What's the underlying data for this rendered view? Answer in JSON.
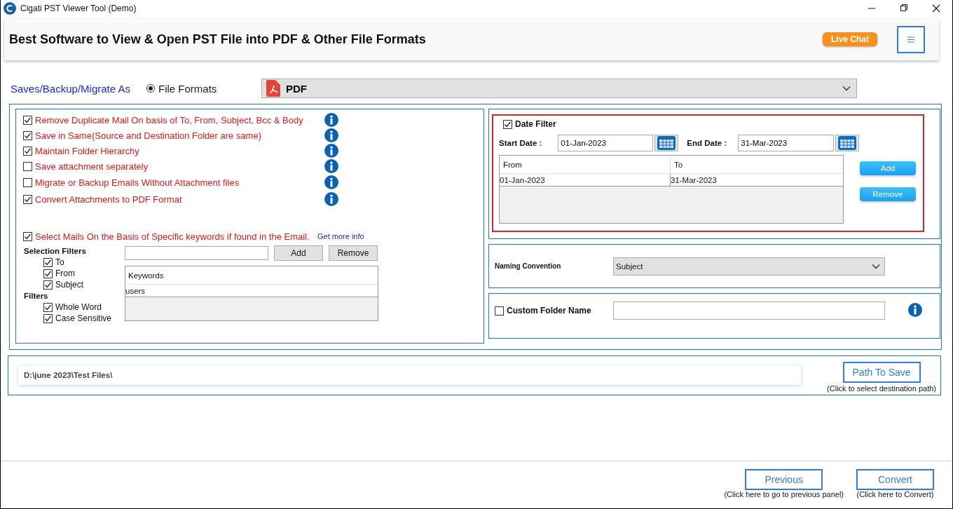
{
  "window": {
    "title": "Cigati PST Viewer Tool (Demo)"
  },
  "header": {
    "headline": "Best Software to View & Open PST File into PDF & Other File Formats",
    "live_chat": "Live Chat"
  },
  "save_as": {
    "label": "Saves/Backup/Migrate As",
    "option": {
      "label": "File Formats",
      "selected": true
    },
    "format": "PDF"
  },
  "options": [
    {
      "label": "Remove Duplicate Mail On basis of To, From, Subject, Bcc & Body",
      "checked": true
    },
    {
      "label": "Save in Same(Source and Destination Folder are same)",
      "checked": true
    },
    {
      "label": "Maintain Folder Hierarchy",
      "checked": true
    },
    {
      "label": "Save attachment separately",
      "checked": false
    },
    {
      "label": "Migrate or Backup Emails Without Attachment files",
      "checked": false
    },
    {
      "label": "Convert Attachments to PDF Format",
      "checked": true
    }
  ],
  "keyword_filter": {
    "label": "Select Mails On the Basis of Specific keywords if found in the Email.",
    "checked": true,
    "link": "Get more info",
    "selection_filters_title": "Selection Filters",
    "selection_filters": [
      {
        "label": "To",
        "checked": true
      },
      {
        "label": "From",
        "checked": true
      },
      {
        "label": "Subject",
        "checked": true
      }
    ],
    "filters_title": "Filters",
    "filters": [
      {
        "label": "Whole Word",
        "checked": true
      },
      {
        "label": "Case Sensitive",
        "checked": true
      }
    ],
    "add": "Add",
    "remove": "Remove",
    "table": {
      "columns": [
        "Keywords"
      ],
      "rows": [
        [
          "users"
        ]
      ]
    }
  },
  "date_filter": {
    "label": "Date Filter",
    "checked": true,
    "start_label": "Start Date :",
    "start_value": "01-Jan-2023",
    "end_label": "End Date :",
    "end_value": "31-Mar-2023",
    "table": {
      "columns": [
        "From",
        "To"
      ],
      "rows": [
        [
          "01-Jan-2023",
          "31-Mar-2023"
        ]
      ]
    },
    "add": "Add",
    "remove": "Remove"
  },
  "naming": {
    "label": "Naming Convention",
    "value": "Subject"
  },
  "custom_folder": {
    "label": "Custom Folder Name",
    "checked": false
  },
  "path": {
    "value": "D:\\june 2023\\Test Files\\",
    "button": "Path To Save",
    "hint": "(Click to select destination path)"
  },
  "footer": {
    "buttons": [
      {
        "label": "Previous",
        "hint": "(Click here to go to previous panel)"
      },
      {
        "label": "Convert",
        "hint": "(Click here to Convert)"
      }
    ]
  }
}
